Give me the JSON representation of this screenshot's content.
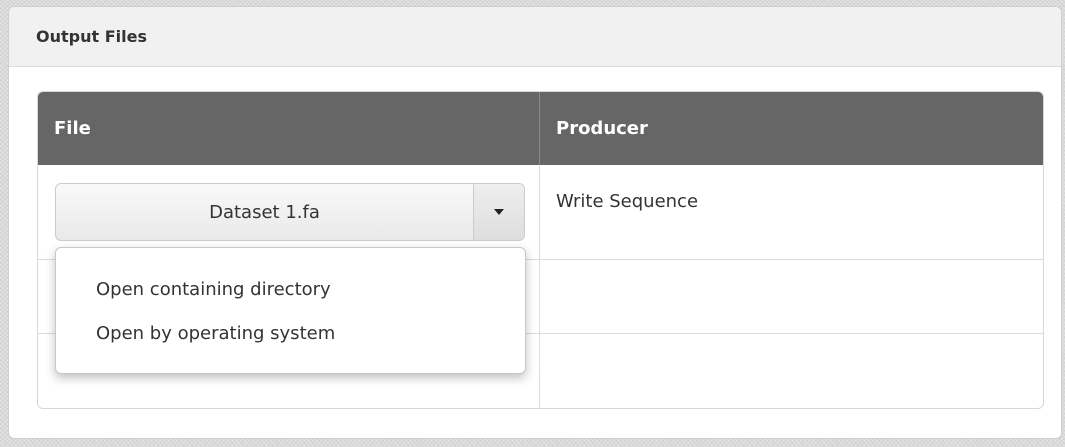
{
  "panel": {
    "title": "Output Files"
  },
  "table": {
    "columns": {
      "file": "File",
      "producer": "Producer"
    },
    "rows": [
      {
        "file": "Dataset 1.fa",
        "producer": "Write Sequence"
      },
      {
        "file": "",
        "producer": ""
      },
      {
        "file": "",
        "producer": ""
      }
    ]
  },
  "dropdown": {
    "toggle_icon": "caret-down-icon",
    "items": [
      {
        "label": "Open containing directory"
      },
      {
        "label": "Open by operating system"
      }
    ]
  },
  "colors": {
    "header_bg": "#666666",
    "panel_header_bg": "#f1f1f1",
    "page_bg": "#d9d9d9"
  }
}
